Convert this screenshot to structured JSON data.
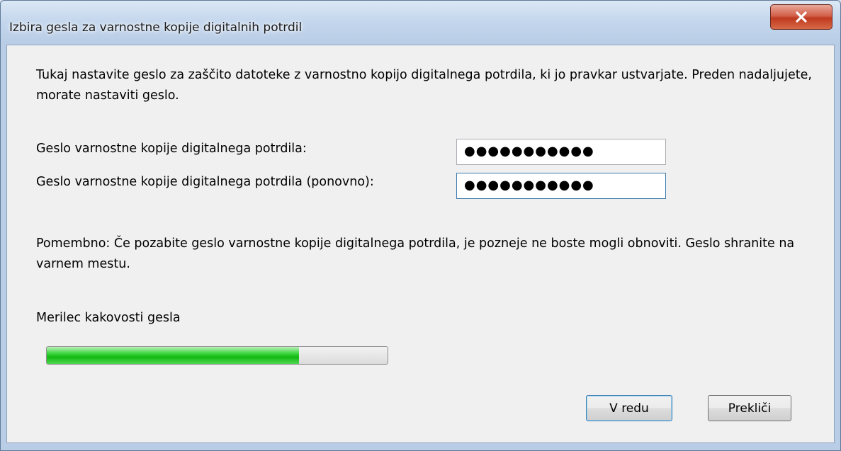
{
  "window": {
    "title": "Izbira gesla za varnostne kopije digitalnih potrdil",
    "close_icon": "close-x-icon"
  },
  "intro": {
    "text": "Tukaj nastavite geslo za zaščito datoteke z varnostno kopijo digitalnega potrdila, ki jo pravkar ustvarjate. Preden nadaljujete, morate nastaviti geslo."
  },
  "fields": {
    "password_label": "Geslo varnostne kopije digitalnega potrdila:",
    "password_value": "●●●●●●●●●●●",
    "confirm_label": "Geslo varnostne kopije digitalnega potrdila (ponovno):",
    "confirm_value": "●●●●●●●●●●●"
  },
  "important": {
    "text": "Pomembno: Če pozabite geslo varnostne kopije digitalnega potrdila, je pozneje ne boste mogli obnoviti. Geslo shranite na varnem mestu."
  },
  "strength_meter": {
    "label": "Merilec kakovosti gesla",
    "level_percent": 74,
    "color": "#1ec21e"
  },
  "buttons": {
    "ok_label": "V redu",
    "cancel_label": "Prekliči"
  }
}
